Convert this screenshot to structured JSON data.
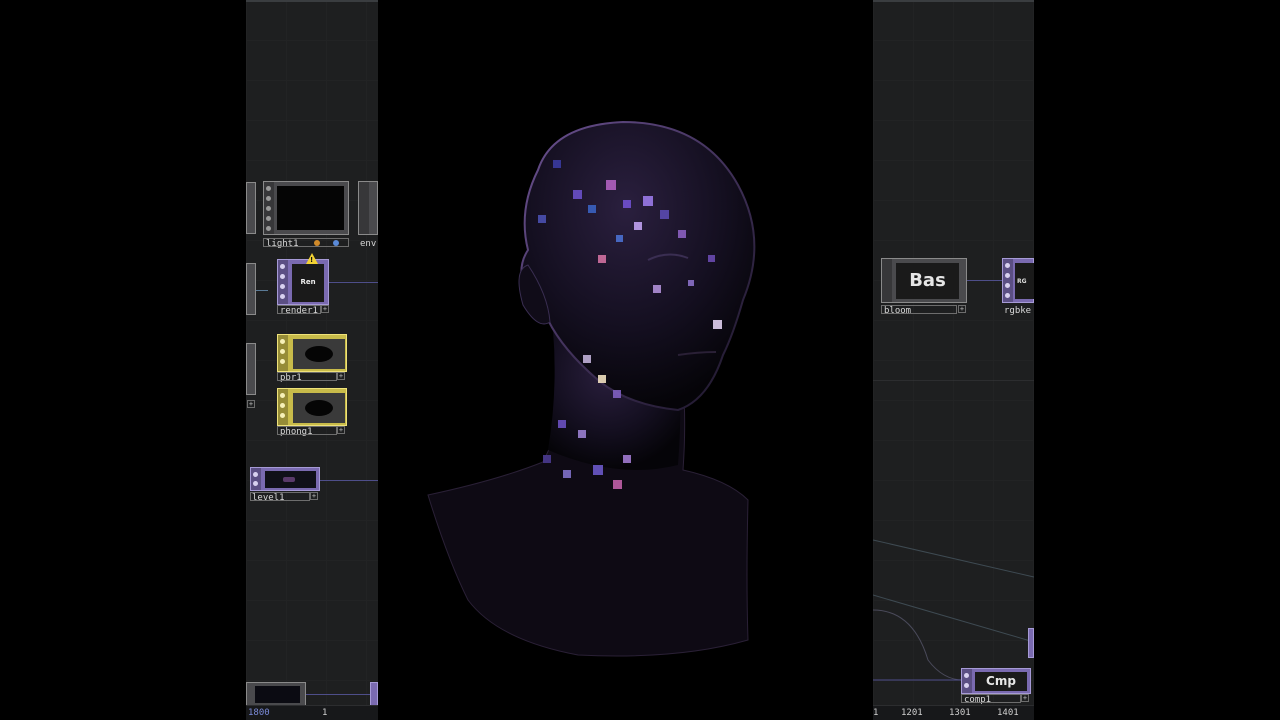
{
  "left_panel": {
    "nodes": {
      "light": {
        "label": "light1"
      },
      "env": {
        "label": "env"
      },
      "render": {
        "label": "render1",
        "thumb_text": "Ren",
        "warning": "!"
      },
      "pbr": {
        "label": "pbr1"
      },
      "phong": {
        "label": "phong1"
      },
      "level": {
        "label": "level1"
      }
    },
    "timeline": {
      "frame_left": "1800",
      "frame_right": "1"
    }
  },
  "right_panel": {
    "nodes": {
      "bloom": {
        "label": "bloom",
        "thumb_text": "Bas"
      },
      "rgbkey": {
        "label": "rgbke",
        "thumb_text": "RG"
      },
      "comp": {
        "label": "comp1",
        "thumb_text": "Cmp"
      }
    },
    "timeline": {
      "ticks": [
        "1",
        "1201",
        "1301",
        "1401"
      ]
    }
  },
  "viewport": {
    "subject": "disco-mosaic-head"
  },
  "colors": {
    "background": "#000000",
    "panel": "#1e1f20",
    "top_node": "#7a6ab0",
    "material_node": "#c8bb4a",
    "wire": "#4e4e8a"
  }
}
